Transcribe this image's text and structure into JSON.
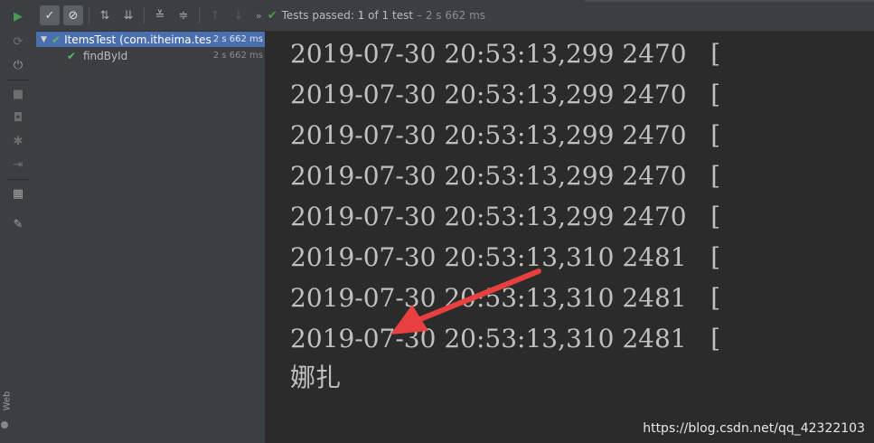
{
  "toolbar": {
    "status_icon": "check-icon",
    "status_label": "Tests passed:",
    "status_count": "1",
    "status_rest": "of 1 test",
    "status_time": "– 2 s 662 ms"
  },
  "tree": {
    "root": {
      "name": "ItemsTest (com.itheima.tes",
      "time": "2 s 662 ms"
    },
    "child": {
      "name": "findById",
      "time": "2 s 662 ms"
    }
  },
  "console": {
    "lines": [
      "2019-07-30 20:53:13,299 2470   [",
      "2019-07-30 20:53:13,299 2470   [",
      "2019-07-30 20:53:13,299 2470   [",
      "2019-07-30 20:53:13,299 2470   [",
      "2019-07-30 20:53:13,299 2470   [",
      "2019-07-30 20:53:13,310 2481   [",
      "2019-07-30 20:53:13,310 2481   [",
      "2019-07-30 20:53:13,310 2481   [",
      "娜扎"
    ],
    "watermark": "https://blog.csdn.net/qq_42322103"
  },
  "sidebar": {
    "web_label": "Web"
  },
  "colors": {
    "accent": "#4b6eaf",
    "pass": "#499c54",
    "arrow": "#e8403e"
  }
}
